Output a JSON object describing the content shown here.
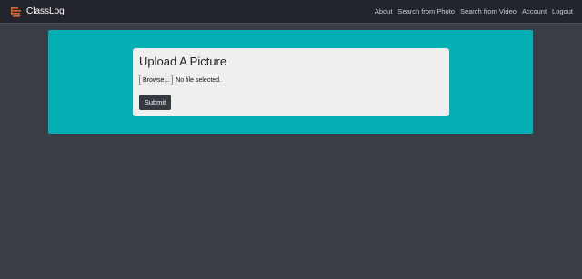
{
  "navbar": {
    "brand": "ClassLog",
    "brand_icon": "classlog-logo-icon",
    "brand_icon_color": "#e0652e",
    "links": [
      "About",
      "Search from Photo",
      "Search from Video",
      "Account",
      "Logout"
    ]
  },
  "upload": {
    "title": "Upload A Picture",
    "browse_label": "Browse...",
    "file_status": "No file selected.",
    "submit_label": "Submit"
  },
  "colors": {
    "background": "#3a3e47",
    "navbar": "#22262c",
    "jumbotron": "#03aeb4",
    "card": "#efefef",
    "submit_button": "#343a40"
  }
}
